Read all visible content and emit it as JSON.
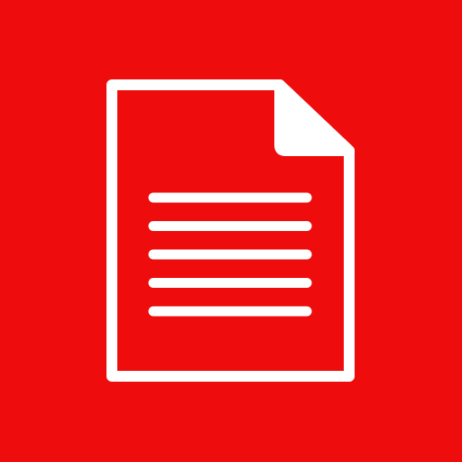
{
  "icon": {
    "name": "document-icon",
    "background_color": "#ee0c0c",
    "foreground_color": "#ffffff",
    "text_line_count": 5
  }
}
